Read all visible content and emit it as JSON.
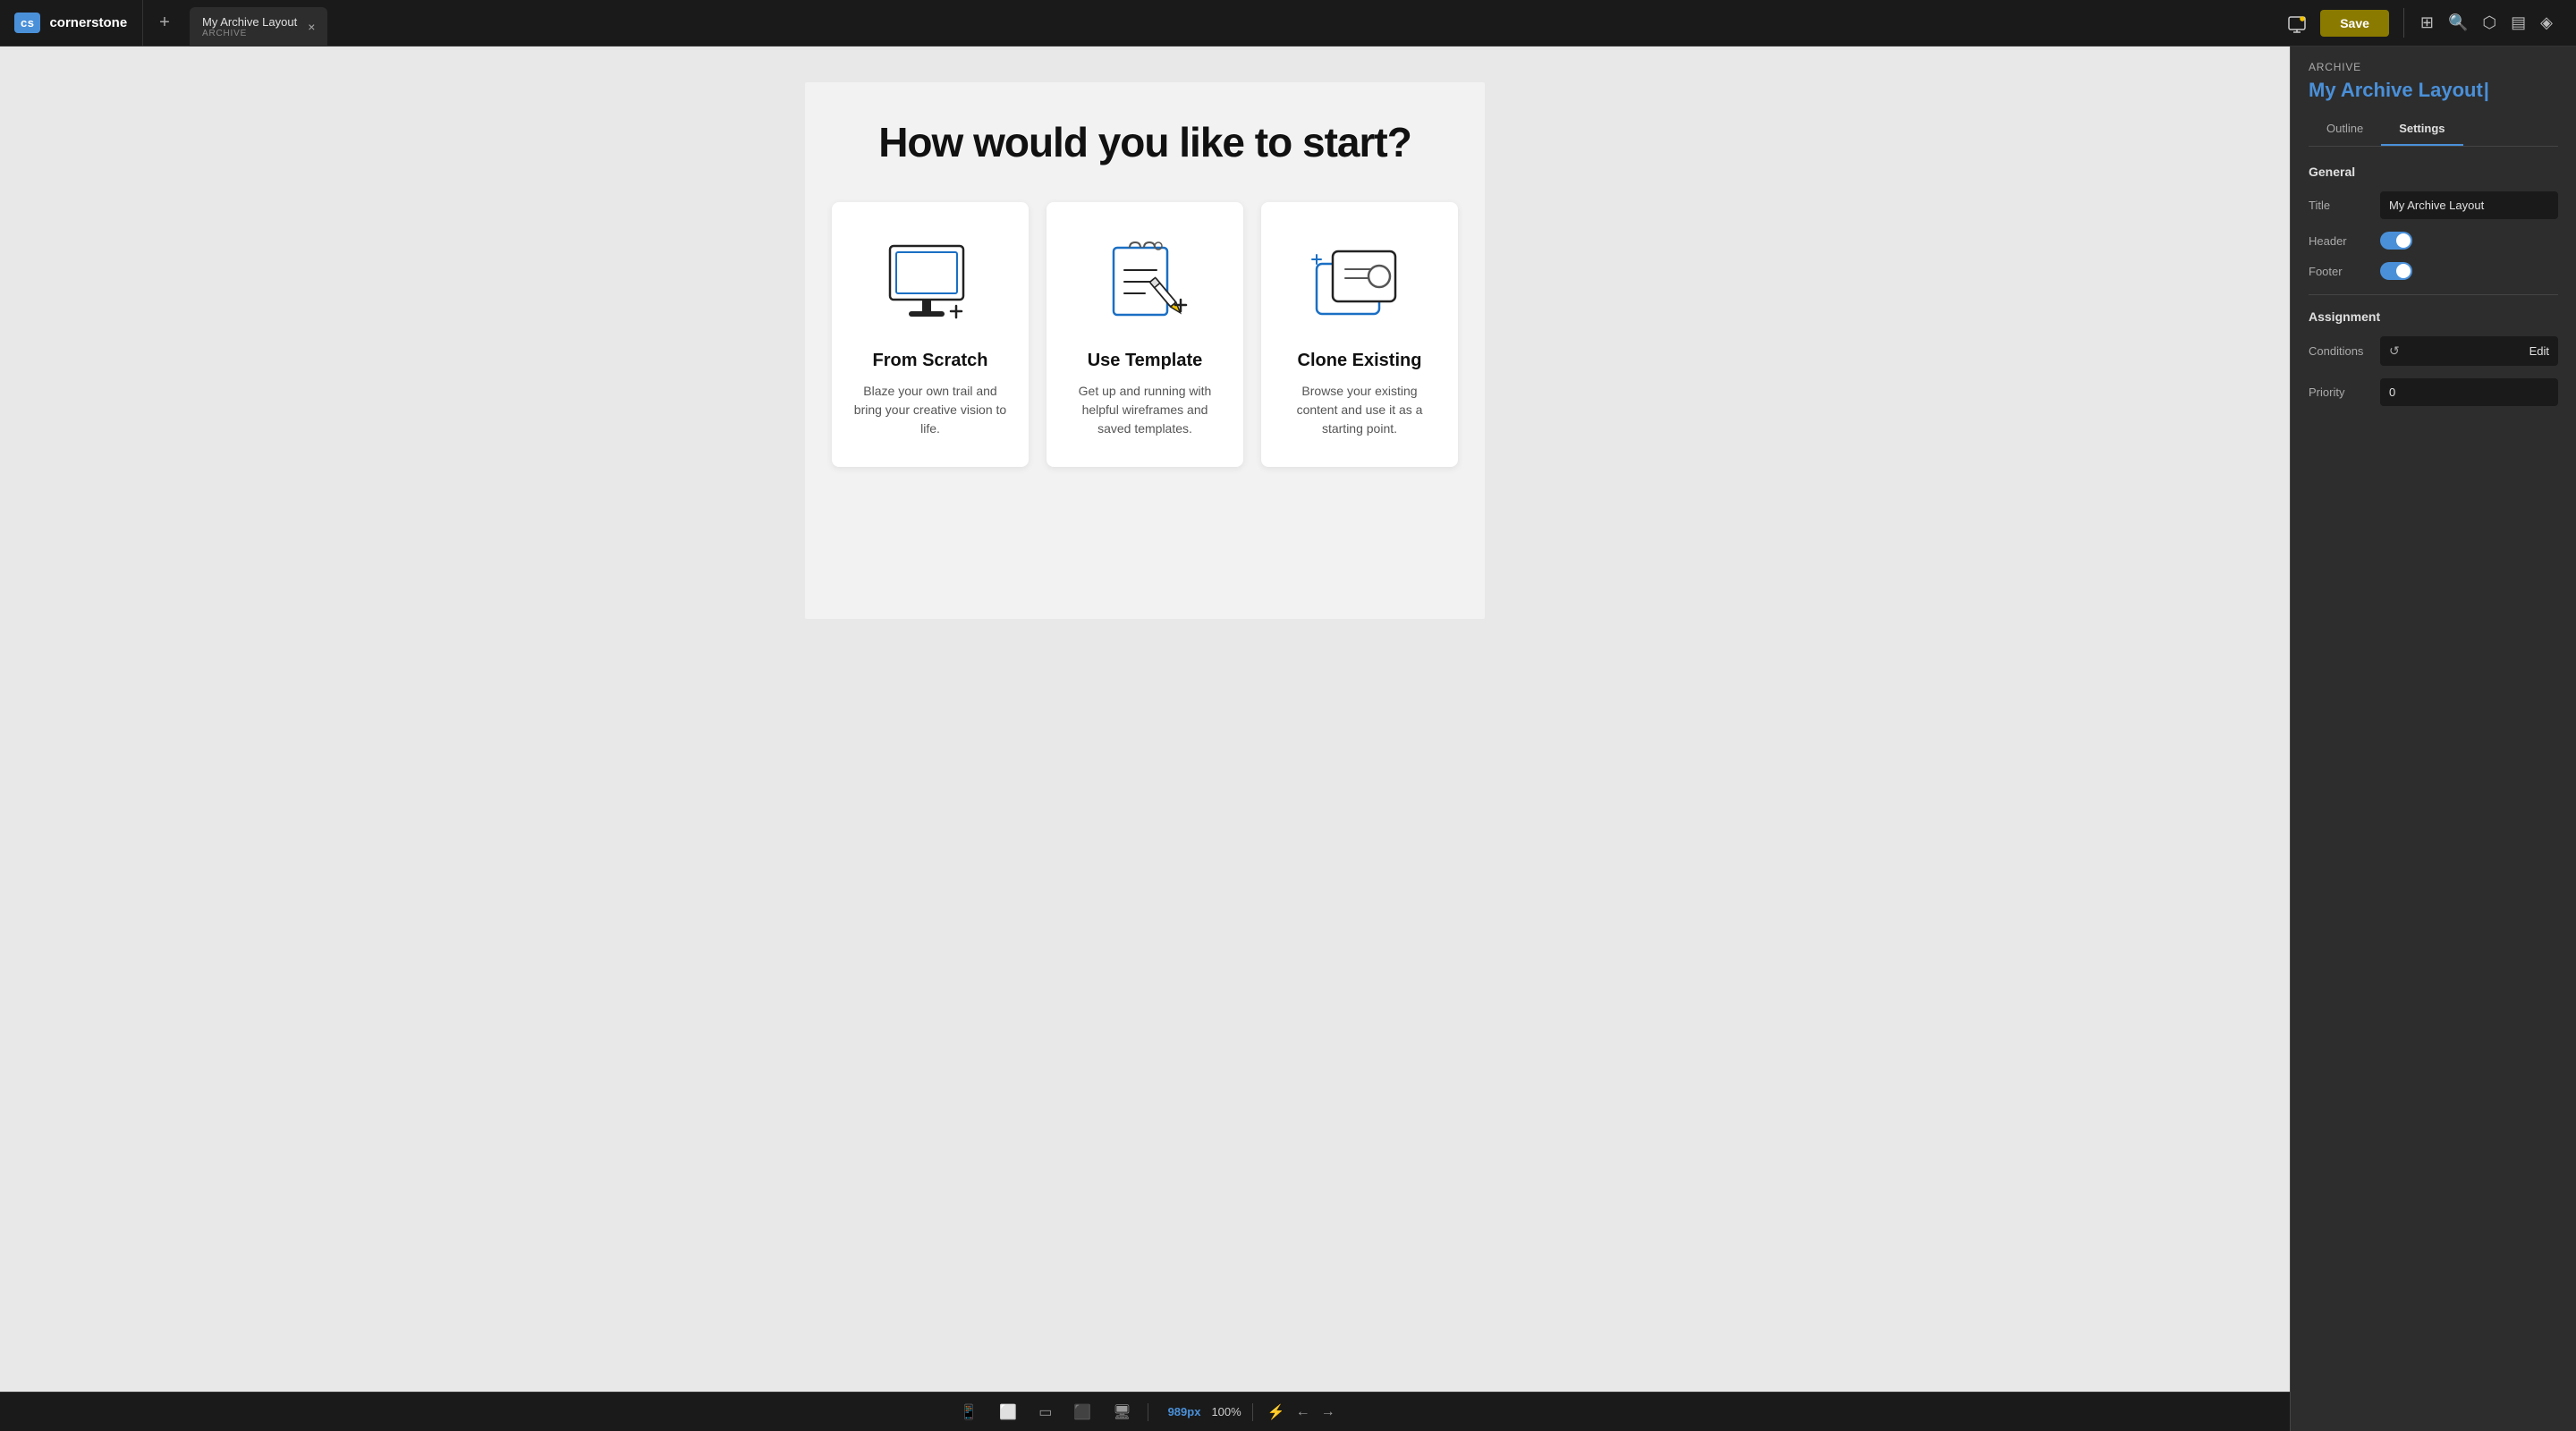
{
  "app": {
    "logo_text": "cs",
    "brand_name": "cornerstone"
  },
  "top_bar": {
    "add_button_label": "+",
    "tab": {
      "title": "My Archive Layout",
      "subtitle": "ARCHIVE",
      "close_label": "×"
    },
    "save_button": "Save"
  },
  "canvas": {
    "page_title": "How would you like to start?",
    "cards": [
      {
        "id": "scratch",
        "title": "From Scratch",
        "description": "Blaze your own trail and bring your creative vision to life."
      },
      {
        "id": "template",
        "title": "Use Template",
        "description": "Get up and running with helpful wireframes and saved templates."
      },
      {
        "id": "clone",
        "title": "Clone Existing",
        "description": "Browse your existing content and use it as a starting point."
      }
    ]
  },
  "bottom_bar": {
    "px_value": "989",
    "px_unit": "px",
    "zoom_value": "100%",
    "separator": "×"
  },
  "right_panel": {
    "section_label": "Archive",
    "layout_title": "My Archive Layout",
    "tabs": [
      "Outline",
      "Settings"
    ],
    "active_tab": "Settings",
    "general": {
      "title": "General",
      "title_label": "Title",
      "title_value": "My Archive Layout",
      "header_label": "Header",
      "header_enabled": true,
      "footer_label": "Footer",
      "footer_enabled": true
    },
    "assignment": {
      "title": "Assignment",
      "conditions_label": "Conditions",
      "conditions_button": "Edit",
      "priority_label": "Priority",
      "priority_value": "0"
    }
  }
}
